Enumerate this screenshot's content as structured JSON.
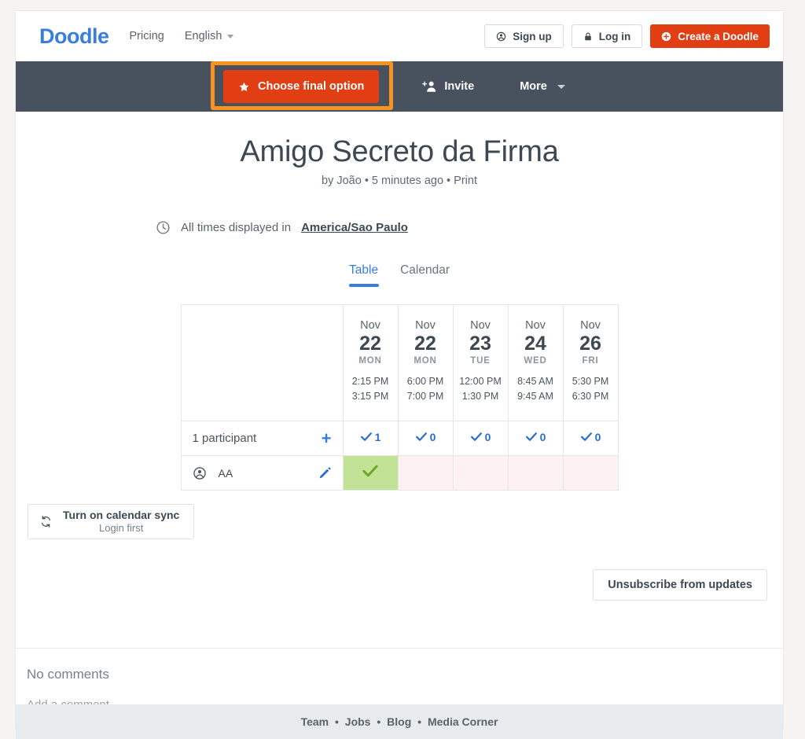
{
  "topbar": {
    "logo": "Doodle",
    "pricing": "Pricing",
    "language": "English",
    "signup": "Sign up",
    "login": "Log in",
    "create": "Create a Doodle"
  },
  "nav": {
    "choose_final_option": "Choose final option",
    "invite": "Invite",
    "more": "More",
    "highlight_color": "#f79421",
    "cta_color": "#e13e14",
    "bar_color": "#47525e"
  },
  "poll": {
    "title": "Amigo Secreto da Firma",
    "subtitle": "by João • 5 minutes ago • Print",
    "timezone_prefix": "All times displayed in",
    "timezone": "America/Sao Paulo",
    "tabs": [
      {
        "label": "Table",
        "active": true
      },
      {
        "label": "Calendar",
        "active": false
      }
    ],
    "columns": [
      {
        "month": "Nov",
        "day": "22",
        "dow": "MON",
        "start": "2:15 PM",
        "end": "3:15 PM",
        "votes": "1"
      },
      {
        "month": "Nov",
        "day": "22",
        "dow": "MON",
        "start": "6:00 PM",
        "end": "7:00 PM",
        "votes": "0"
      },
      {
        "month": "Nov",
        "day": "23",
        "dow": "TUE",
        "start": "12:00 PM",
        "end": "1:30 PM",
        "votes": "0"
      },
      {
        "month": "Nov",
        "day": "24",
        "dow": "WED",
        "start": "8:45 AM",
        "end": "9:45 AM",
        "votes": "0"
      },
      {
        "month": "Nov",
        "day": "26",
        "dow": "FRI",
        "start": "5:30 PM",
        "end": "6:30 PM",
        "votes": "0"
      }
    ],
    "participant_count_label": "1 participant",
    "add_participant_icon": "plus-icon",
    "participants": [
      {
        "name": "AA",
        "avatar_icon": "person-circle-icon",
        "edit_icon": "pencil-icon",
        "answers": [
          "yes",
          "no",
          "no",
          "no",
          "no"
        ]
      }
    ],
    "yes_color": "#c2e295",
    "no_color": "#fdf1f1",
    "vote_color": "#2b6cd4"
  },
  "calendar_sync": {
    "title": "Turn on calendar sync",
    "subtitle": "Login first",
    "icon": "sync-icon"
  },
  "unsubscribe": {
    "label": "Unsubscribe from updates"
  },
  "comments": {
    "empty": "No comments",
    "placeholder": "Add a comment"
  },
  "footer": {
    "links": [
      "Team",
      "Jobs",
      "Blog",
      "Media Corner"
    ],
    "separator": "•"
  }
}
